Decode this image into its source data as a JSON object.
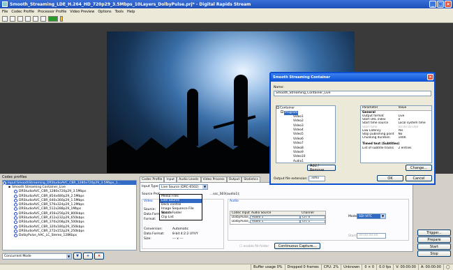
{
  "window": {
    "title": "Smooth_Streaming_LDE_H.264_HD_720p29_3.5Mbps_10Layers_DolbyPulse.prj* - Digital Rapids Stream"
  },
  "menu": [
    "File",
    "Codec Profile",
    "Processor Profile",
    "Video Preview",
    "Options",
    "Tools",
    "Help"
  ],
  "codec_profiles": {
    "title": "Codec profiles",
    "nodes": [
      {
        "label": "Smooth Streaming Container_Live",
        "indent": 1,
        "selected": false
      },
      {
        "label": "DRStudioAVC_CBR_1280x720p29_3.5Mbps",
        "indent": 2
      },
      {
        "label": "DRStudioAVC_CBR_854x480p29_2.5Mbps",
        "indent": 2
      },
      {
        "label": "DRStudioAVC_CBR_640x360p29_1.5Mbps",
        "indent": 2
      },
      {
        "label": "DRStudioAVC_CBR_576x324p29_1.2Mbps",
        "indent": 2
      },
      {
        "label": "DRStudioAVC_CBR_512x288p29_1Mbps",
        "indent": 2
      },
      {
        "label": "DRStudioAVC_CBR_456x256p29_800kbps",
        "indent": 2
      },
      {
        "label": "DRStudioAVC_CBR_412x232p29_650kbps",
        "indent": 2
      },
      {
        "label": "DRStudioAVC_CBR_370x208p29_500kbps",
        "indent": 2
      },
      {
        "label": "DRStudioAVC_CBR_320x180p29_350kbps",
        "indent": 2
      },
      {
        "label": "DRStudioAVC_CBR_272x152p29_250kbps",
        "indent": 2
      },
      {
        "label": "DolbyPulse_AAC_LC_Stereo_128Kbps",
        "indent": 2
      }
    ],
    "top_selected_label": "Input:SmoothStreaming_DRStudioAVC_CBR_1280x720p29_3.5Mbps_1...",
    "mode": "Concurrent Mode"
  },
  "tabs": [
    "Codec Profile",
    "Input",
    "Audio Levels",
    "Video Process",
    "Output",
    "Statistics"
  ],
  "input_panel": {
    "input_type_label": "Input Type:",
    "input_type_value": "Live Source (DRC-6502)",
    "source_prefix": "Source Prof",
    "source_value": "...ssc_S03(audio1);",
    "dropdown": [
      "Media Files",
      "Live Source",
      "Deck control",
      "Image Sequence File Source",
      "Watch Folder",
      "Clip List"
    ],
    "dropdown_highlight": 1,
    "video_group": "Video",
    "audio_group": "Audio",
    "source_label": "Source:",
    "data_format_label": "Data Forma",
    "format_label": "Format:",
    "format_value": "Unknown",
    "conversion_label": "Conversion:",
    "conversion_value": "Automatic",
    "data_format2_label": "Data Format:",
    "data_format2_value": "8-bit 4:2:2 UYVY",
    "size_label": "Size:",
    "size_value": "--- x ---",
    "audio_table_headers": [
      "Codec Input",
      "Audio Source",
      "Channel"
    ],
    "audio_rows": [
      {
        "codec": "DolbyPulse_...",
        "source": "Audio 1",
        "channel": "Ch. 0"
      },
      {
        "codec": "DolbyPulse_...",
        "source": "Audio 1",
        "channel": "Ch. 1"
      }
    ],
    "mode_label": "Mode:",
    "mode_value": "SDI VITC",
    "start_label": "Start:",
    "start_value": "00:00:00:00",
    "enable_fill_label": "enable fill-folder",
    "continuous_capture": "Continuous Capture..."
  },
  "right_buttons": [
    "Trigger...",
    "Prepare",
    "Start",
    "Stop"
  ],
  "status": {
    "buffer": "Buffer usage 0%",
    "dropped": "Dropped 0 frames",
    "cpu": "CPU: 2%",
    "unknown": "Unknown",
    "res": "0 × 0",
    "fps": "0.0 fps",
    "v": "V: 00:00:00",
    "a": "A: 00:00:00"
  },
  "dialog": {
    "title": "Smooth Streaming Container",
    "name_label": "Name:",
    "name_value": "Smooth_Streaming_Container_Live",
    "tree": [
      "Container",
      "Program",
      "Video1",
      "Video2",
      "Video3",
      "Video4",
      "Video5",
      "Video6",
      "Video7",
      "Video8",
      "Video9",
      "Video10",
      "Audio1"
    ],
    "add_remove": "Add / Remove",
    "param_headers": [
      "Parameter",
      "Value"
    ],
    "general_section": "General",
    "params": [
      {
        "p": "Output format",
        "v": "Live"
      },
      {
        "p": "Start URL index",
        "v": "0"
      },
      {
        "p": "Start time source",
        "v": "Local system time"
      },
      {
        "p": "Start time",
        "v": "00:00:00.000",
        "grey": true
      },
      {
        "p": "Low Latency",
        "v": "Yes"
      },
      {
        "p": "Stop publishing point",
        "v": "No"
      },
      {
        "p": "Chunking duration",
        "v": "1000"
      }
    ],
    "timed_section": "Timed text (Subtitles)",
    "timed_params": [
      {
        "p": "List of subtitle tracks",
        "v": "2 entries"
      }
    ],
    "change_btn": "Change...",
    "ext_label": "Output file extension:",
    "ext_value": ".ismv",
    "ok": "OK",
    "cancel": "Cancel"
  }
}
